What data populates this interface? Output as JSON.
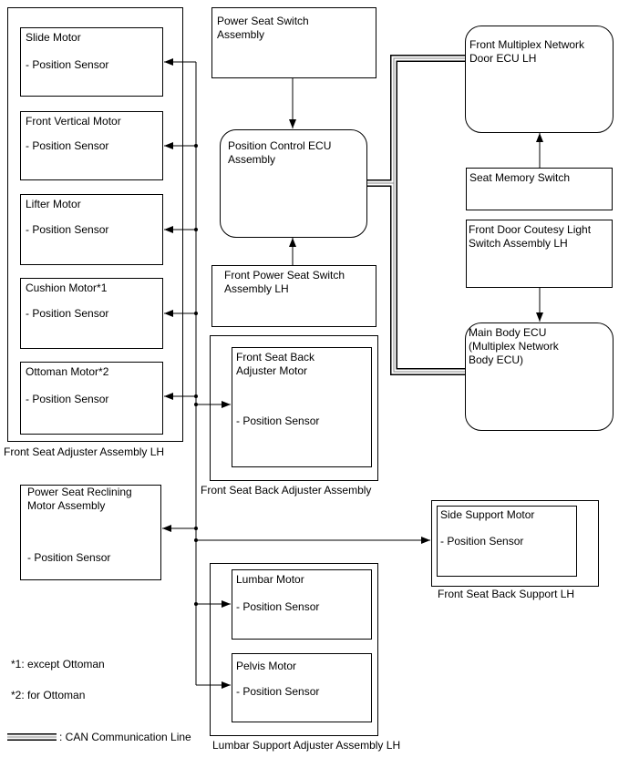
{
  "adjuster_assembly": {
    "label": "Front Seat Adjuster Assembly LH",
    "motors": [
      {
        "name": "Slide Motor",
        "sensor": "- Position Sensor"
      },
      {
        "name": "Front Vertical Motor",
        "sensor": "- Position Sensor"
      },
      {
        "name": "Lifter Motor",
        "sensor": "- Position Sensor"
      },
      {
        "name": "Cushion Motor*1",
        "sensor": "- Position Sensor"
      },
      {
        "name": "Ottoman Motor*2",
        "sensor": "- Position Sensor"
      }
    ]
  },
  "power_seat_switch": "Power Seat Switch\nAssembly",
  "position_ecu": "Position Control ECU\nAssembly",
  "front_power_seat_switch": "Front Power Seat Switch\nAssembly LH",
  "back_adjuster": {
    "label": "Front Seat Back Adjuster Assembly",
    "motor": "Front Seat Back\nAdjuster Motor",
    "sensor": "- Position Sensor"
  },
  "recliner": {
    "name": "Power Seat Reclining\nMotor Assembly",
    "sensor": "- Position Sensor"
  },
  "door_ecu": "Front Multiplex Network\nDoor ECU LH",
  "seat_memory_switch": "Seat Memory Switch",
  "courtesy_switch": "Front Door Coutesy Light\nSwitch Assembly LH",
  "main_body_ecu": "Main Body ECU\n(Multiplex Network\nBody ECU)",
  "side_support": {
    "label": "Front Seat Back Support LH",
    "motor": "Side Support Motor",
    "sensor": "- Position Sensor"
  },
  "lumbar_assembly": {
    "label": "Lumbar Support Adjuster Assembly LH",
    "lumbar": {
      "name": "Lumbar Motor",
      "sensor": "- Position Sensor"
    },
    "pelvis": {
      "name": "Pelvis Motor",
      "sensor": "- Position Sensor"
    }
  },
  "notes": {
    "n1": "*1: except Ottoman",
    "n2": "*2: for Ottoman"
  },
  "legend": {
    "can": ": CAN Communication Line"
  }
}
